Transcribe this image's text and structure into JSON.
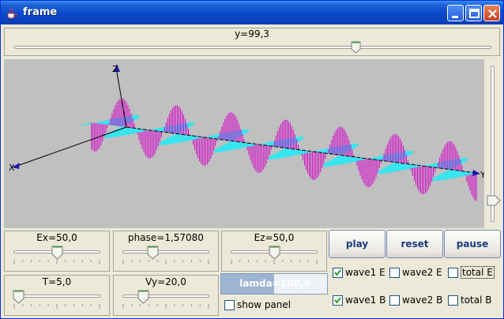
{
  "window": {
    "title": "frame"
  },
  "top_slider": {
    "label": "y=99,3",
    "value_fraction": 0.73
  },
  "viewport": {
    "axis_labels": {
      "x": "X",
      "y": "Y",
      "z": "Z"
    },
    "colors": {
      "background": "#c0c0c0",
      "wave_e": "#33e6f0",
      "wave_b": "#d400c8",
      "axis": "#000000",
      "arrow": "#1a1aa8"
    }
  },
  "right_slider": {
    "value_fraction": 0.9
  },
  "sliders": [
    {
      "id": "ex",
      "label": "Ex=50,0",
      "value_fraction": 0.5
    },
    {
      "id": "phase",
      "label": "phase=1,57080",
      "value_fraction": 0.33
    },
    {
      "id": "ez",
      "label": "Ez=50,0",
      "value_fraction": 0.5
    },
    {
      "id": "t",
      "label": "T=5,0",
      "value_fraction": 0.0
    },
    {
      "id": "vy",
      "label": "Vy=20,0",
      "value_fraction": 0.2
    }
  ],
  "lamda": {
    "label": "lamda=100,0",
    "fill_fraction": 0.5
  },
  "show_panel": {
    "label": "show panel",
    "checked": false
  },
  "buttons": {
    "play": "play",
    "reset": "reset",
    "pause": "pause"
  },
  "checkboxes": [
    {
      "id": "wave1e",
      "label": "wave1 E",
      "checked": true
    },
    {
      "id": "wave2e",
      "label": "wave2 E",
      "checked": false
    },
    {
      "id": "totale",
      "label": "total E",
      "checked": false
    },
    {
      "id": "wave1b",
      "label": "wave1 B",
      "checked": true
    },
    {
      "id": "wave2b",
      "label": "wave2 B",
      "checked": false
    },
    {
      "id": "totalb",
      "label": "total B",
      "checked": false
    }
  ]
}
